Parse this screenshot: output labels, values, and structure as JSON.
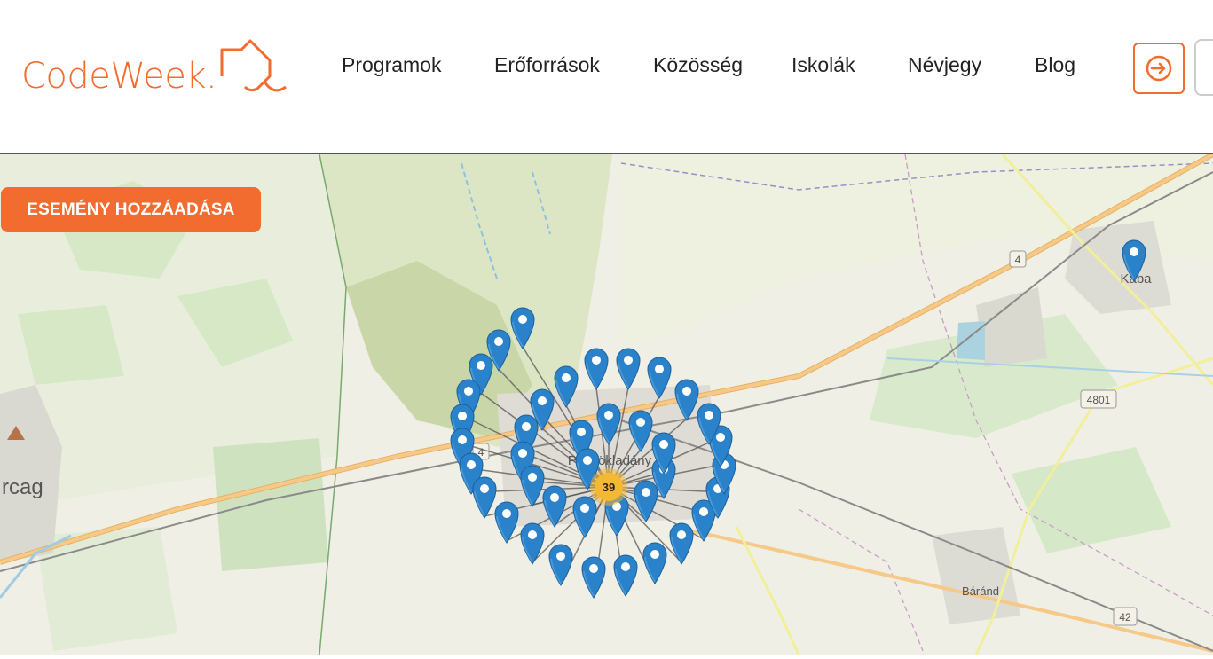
{
  "header": {
    "logo": {
      "text": "CodeWeek."
    },
    "nav": [
      {
        "label": "Programok"
      },
      {
        "label": "Erőforrások"
      },
      {
        "label": "Közösség"
      },
      {
        "label": "Iskolák"
      },
      {
        "label": "Névjegy"
      },
      {
        "label": "Blog"
      }
    ],
    "login_icon": "sign-in-icon"
  },
  "map": {
    "add_event_label": "ESEMÉNY HOZZÁADÁSA",
    "cluster": {
      "count": "39"
    },
    "place_labels": {
      "kaba": "Kaba",
      "puspokladany": "Püspökladány",
      "barand": "Báránd",
      "karcag": "rcag"
    },
    "road_labels": {
      "r4_top": "4",
      "r4_left": "4",
      "r4801": "4801",
      "r42": "42"
    },
    "colors": {
      "marker": "#2a82cb",
      "cluster": "#f5b833",
      "accent": "#f26b2f"
    }
  }
}
